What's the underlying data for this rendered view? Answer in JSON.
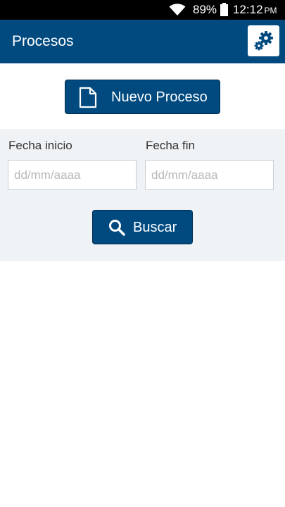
{
  "status_bar": {
    "battery_percent": "89%",
    "time": "12:12",
    "ampm": "PM"
  },
  "app_bar": {
    "title": "Procesos"
  },
  "actions": {
    "new_process_label": "Nuevo Proceso"
  },
  "filters": {
    "start_label": "Fecha inicio",
    "start_placeholder": "dd/mm/aaaa",
    "end_label": "Fecha fin",
    "end_placeholder": "dd/mm/aaaa",
    "search_label": "Buscar"
  },
  "colors": {
    "primary": "#004a80",
    "panel_bg": "#eff3f6"
  },
  "icons": {
    "settings": "gears-icon",
    "new_process": "document-icon",
    "search": "search-icon"
  }
}
